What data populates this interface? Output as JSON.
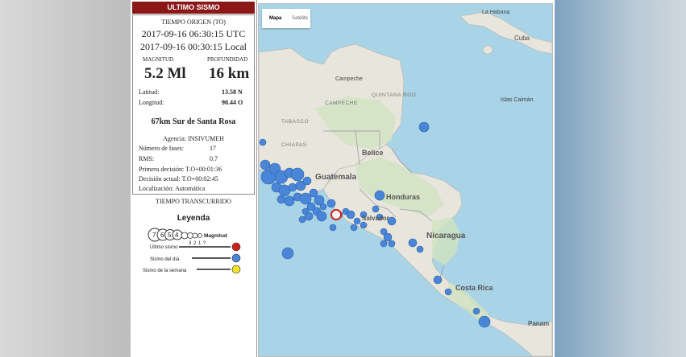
{
  "header": {
    "title": "ULTIMO SISMO"
  },
  "origin": {
    "label": "TIEMPO ORIGEN (TO)",
    "utc": "2017-09-16 06:30:15 UTC",
    "local": "2017-09-16 00:30:15 Local"
  },
  "magnitude": {
    "label": "MAGNITUD",
    "value": "5.2 Ml"
  },
  "depth": {
    "label": "PROFUNDIDAD",
    "value": "16 km"
  },
  "latitude": {
    "label": "Latitud:",
    "value": "13.58 N"
  },
  "longitude": {
    "label": "Longitud:",
    "value": "90.44 O"
  },
  "location": "67km Sur de Santa Rosa",
  "agency": "Agencia: INSIVUMEH",
  "phases": {
    "label": "Número de fases:",
    "value": "17"
  },
  "rms": {
    "label": "RMS:",
    "value": "0.7"
  },
  "first_decision": "Primera decisión: T.O+00:01:36",
  "current_decision": "Decisión actual: T.O+00:02:45",
  "localization": "Localización: Automática",
  "elapsed": {
    "label": "TIEMPO TRANSCURRIDO"
  },
  "legend": {
    "title": "Leyenda",
    "magnitudes_big": [
      "7",
      "6",
      "5",
      "4"
    ],
    "magnitudes_small": [
      "3",
      "2",
      "1",
      "?"
    ],
    "magnitude_label": "Magnitud",
    "items": [
      {
        "label": "Último sismo",
        "color": "#d0201b"
      },
      {
        "label": "Sismo del día",
        "color": "#4a86d8"
      },
      {
        "label": "Sismo de la semana",
        "color": "#f1e22a"
      }
    ]
  },
  "map": {
    "type_buttons": [
      "Mapa",
      "Satélite"
    ],
    "labels": {
      "havana": "La Habana",
      "cuba": "Cuba",
      "campeche_top": "Campeche",
      "campeche": "CAMPECHE",
      "quintana_roo": "QUINTANA ROO",
      "tabasco": "TABASCO",
      "chiapas": "CHIAPAS",
      "belize": "Belice",
      "guatemala": "Guatemala",
      "honduras": "Honduras",
      "salvador": "Salvador",
      "nicaragua": "Nicaragua",
      "costa_rica": "Costa Rica",
      "panama": "Panam",
      "cayman": "Islas Caimán"
    }
  },
  "colors": {
    "header": "#8b1717",
    "event_day": "#4a86d8",
    "last_event": "#d0201b",
    "sea": "#a9d3e6",
    "land": "#e8e6dc"
  }
}
